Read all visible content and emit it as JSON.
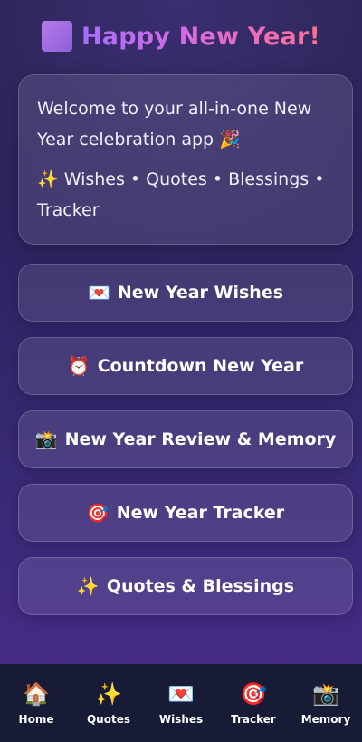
{
  "header": {
    "title": "Happy New Year!"
  },
  "welcome": {
    "line1": "Welcome to your all-in-one New Year celebration app 🎉",
    "line2": "✨ Wishes • Quotes • Blessings • Tracker"
  },
  "menu": [
    {
      "icon": "💌",
      "label": "New Year Wishes"
    },
    {
      "icon": "⏰",
      "label": "Countdown New Year"
    },
    {
      "icon": "📸",
      "label": "New Year Review & Memory"
    },
    {
      "icon": "🎯",
      "label": "New Year Tracker"
    },
    {
      "icon": "✨",
      "label": "Quotes & Blessings"
    }
  ],
  "bottom_nav": [
    {
      "icon": "🏠",
      "label": "Home"
    },
    {
      "icon": "✨",
      "label": "Quotes"
    },
    {
      "icon": "💌",
      "label": "Wishes"
    },
    {
      "icon": "🎯",
      "label": "Tracker"
    },
    {
      "icon": "📸",
      "label": "Memory"
    }
  ],
  "colors": {
    "background_top": "#2b2354",
    "background_bottom": "#4b2c8f",
    "title_gradient_start": "#a66cff",
    "title_gradient_end": "#ff6f91",
    "nav_background": "#171b36"
  }
}
